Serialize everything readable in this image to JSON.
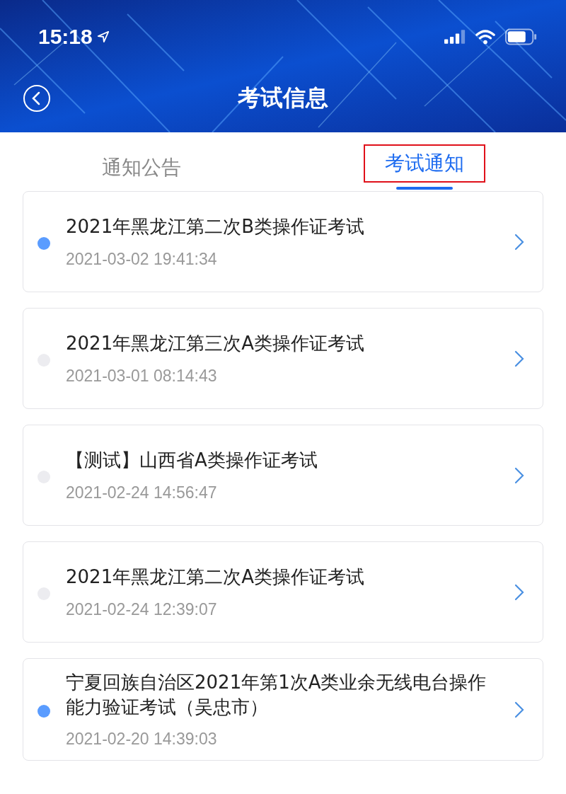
{
  "status_bar": {
    "time": "15:18"
  },
  "header": {
    "title": "考试信息"
  },
  "tabs": [
    {
      "label": "通知公告",
      "selected": false
    },
    {
      "label": "考试通知",
      "selected": true
    }
  ],
  "notices": [
    {
      "title": "2021年黑龙江第二次B类操作证考试",
      "time": "2021-03-02 19:41:34",
      "unread": true
    },
    {
      "title": "2021年黑龙江第三次A类操作证考试",
      "time": "2021-03-01 08:14:43",
      "unread": false
    },
    {
      "title": "【测试】山西省A类操作证考试",
      "time": "2021-02-24 14:56:47",
      "unread": false
    },
    {
      "title": "2021年黑龙江第二次A类操作证考试",
      "time": "2021-02-24 12:39:07",
      "unread": false
    },
    {
      "title": "宁夏回族自治区2021年第1次A类业余无线电台操作能力验证考试（吴忠市）",
      "time": "2021-02-20 14:39:03",
      "unread": true
    }
  ]
}
